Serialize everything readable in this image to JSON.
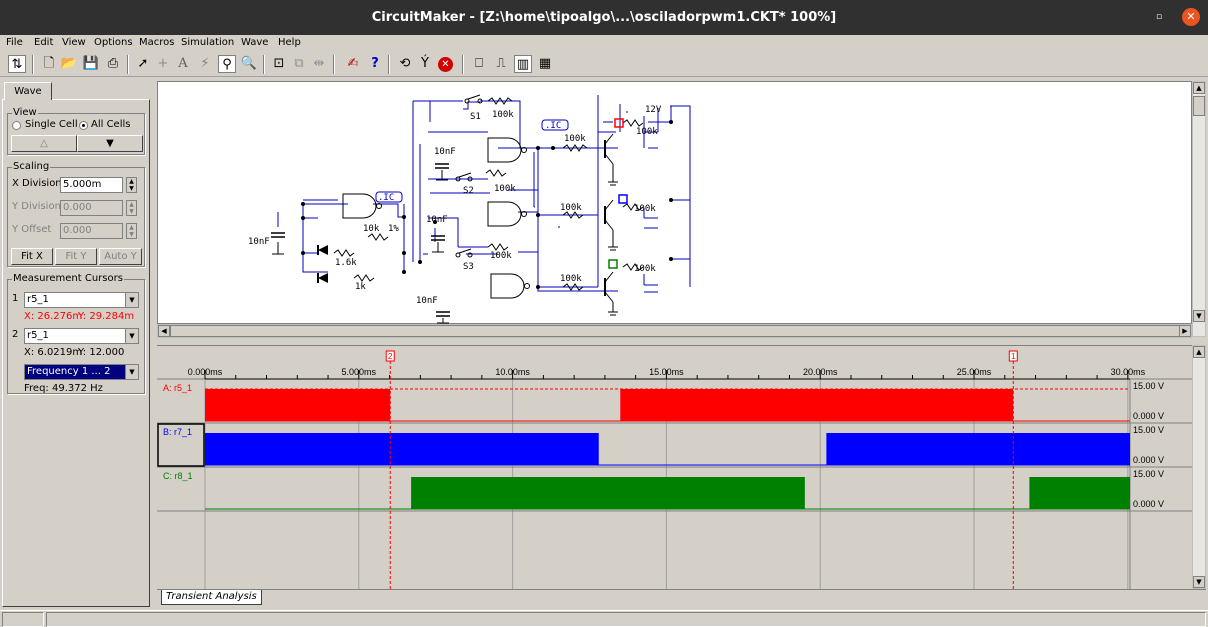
{
  "window": {
    "title": "CircuitMaker - [Z:\\home\\tipoalgo\\...\\osciladorpwm1.CKT* 100%]"
  },
  "menu": [
    "File",
    "Edit",
    "View",
    "Options",
    "Macros",
    "Simulation",
    "Wave",
    "Help"
  ],
  "toolbar_icons": [
    "wire-mode-icon",
    "new-icon",
    "open-icon",
    "save-icon",
    "print-icon",
    "arrow-tool-icon",
    "wire-tool-icon",
    "text-tool-icon",
    "probe-tool-icon",
    "zoom-tool-icon",
    "search-tool-icon",
    "zoom-fit-icon",
    "zoom-area-icon",
    "flip-icon",
    "digital-sim-icon",
    "help-icon",
    "rotate-icon",
    "pin-icon",
    "stop-icon",
    "analog-display-icon",
    "digital-waveform-icon",
    "bar-chart-icon",
    "wave-options-icon"
  ],
  "left_panel": {
    "tab": "Wave",
    "view_group": "View",
    "single_cell": "Single Cell",
    "all_cells": "All Cells",
    "selected_view": "All Cells",
    "scaling_group": "Scaling",
    "x_division_label": "X Division",
    "x_division_value": "5.000m",
    "y_division_label": "Y Division",
    "y_division_value": "0.000",
    "y_offset_label": "Y Offset",
    "y_offset_value": "0.000",
    "fit_x": "Fit X",
    "fit_y": "Fit Y",
    "auto_y": "Auto Y",
    "cursors_group": "Measurement Cursors",
    "cursor1_num": "1",
    "cursor1_signal": "r5_1",
    "cursor1_x": "X: 26.276m",
    "cursor1_y": "Y: 29.284m",
    "cursor2_num": "2",
    "cursor2_signal": "r5_1",
    "cursor2_x": "X: 6.0219m",
    "cursor2_y": "Y: 12.000",
    "measure_select": "Frequency 1 ... 2",
    "measure_result": "Freq:  49.372 Hz"
  },
  "schematic": {
    "labels": [
      "S1",
      "100k",
      ".IC",
      "100k",
      "12V",
      "100k",
      "10nF",
      "S2",
      "100k",
      "10nF",
      "100k",
      "100k",
      ".IC",
      "10nF",
      "10k",
      "1%",
      "1.6k",
      "1k",
      "S3",
      "100k",
      "100k",
      "10nF",
      "100k"
    ]
  },
  "waveform": {
    "axis_unit": "ms",
    "x_ticks": [
      "0.000ms",
      "5.000ms",
      "10.00ms",
      "15.00ms",
      "20.00ms",
      "25.00ms",
      "30.00ms"
    ],
    "x_range_ms": [
      0,
      30
    ],
    "cursor_labels": [
      "2",
      "1"
    ],
    "cursor_positions_ms": [
      6.0219,
      26.276
    ],
    "traces": [
      {
        "label": "A: r5_1",
        "color": "#ff0000",
        "high_segments_ms": [
          [
            0,
            6.02
          ],
          [
            13.5,
            26.27
          ]
        ],
        "top": "15.00 V",
        "bottom": "0.000 V"
      },
      {
        "label": "B: r7_1",
        "color": "#0000ff",
        "high_segments_ms": [
          [
            0,
            12.8
          ],
          [
            20.2,
            30.3
          ]
        ],
        "top": "15.00 V",
        "bottom": "0.000 V"
      },
      {
        "label": "C: r8_1",
        "color": "#008000",
        "high_segments_ms": [
          [
            6.7,
            19.5
          ],
          [
            26.8,
            30.3
          ]
        ],
        "top": "15.00 V",
        "bottom": "0.000 V"
      }
    ]
  },
  "bottom_tab": "Transient Analysis"
}
